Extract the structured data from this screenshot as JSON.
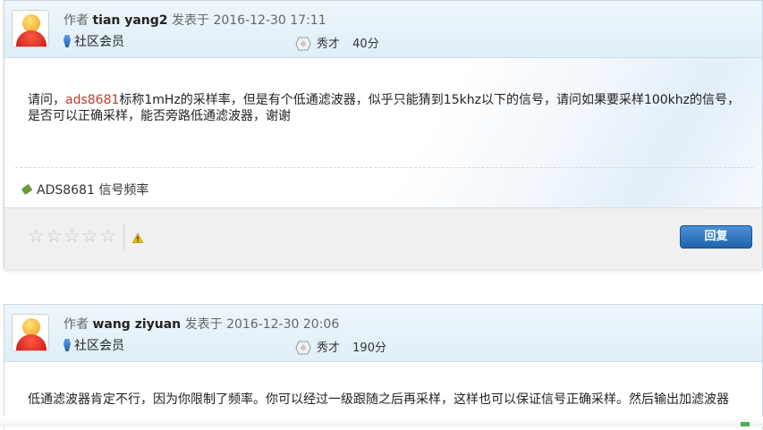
{
  "posts": [
    {
      "author_prefix": "作者",
      "author": "tian yang2",
      "posted_prefix": "发表于",
      "posted_time": "2016-12-30 17:11",
      "role": "社区会员",
      "rank": "秀才",
      "points": "40分",
      "content": {
        "pre": "请问，",
        "link": "ads8681",
        "post": "标称1mHz的采样率，但是有个低通滤波器，似乎只能猜到15khz以下的信号，请问如果要采样100khz的信号，是否可以正确采样，能否旁路低通滤波器，谢谢"
      },
      "tag": "ADS8681 信号频率",
      "reply_label": "回复"
    },
    {
      "author_prefix": "作者",
      "author": "wang ziyuan",
      "posted_prefix": "发表于",
      "posted_time": "2016-12-30 20:06",
      "role": "社区会员",
      "rank": "秀才",
      "points": "190分",
      "content": {
        "text": "低通滤波器肯定不行，因为你限制了频率。你可以经过一级跟随之后再采样，这样也可以保证信号正确采样。然后输出加滤波器"
      }
    }
  ],
  "icons": {
    "rating": "star-outline-icon",
    "report": "warning-icon",
    "tag": "tag-icon",
    "member": "member-badge-icon",
    "rank": "rank-hexagon-icon"
  },
  "colors": {
    "header_bg": "#dfeef8",
    "link": "#c0392b",
    "reply_button": "#1f63ad"
  }
}
